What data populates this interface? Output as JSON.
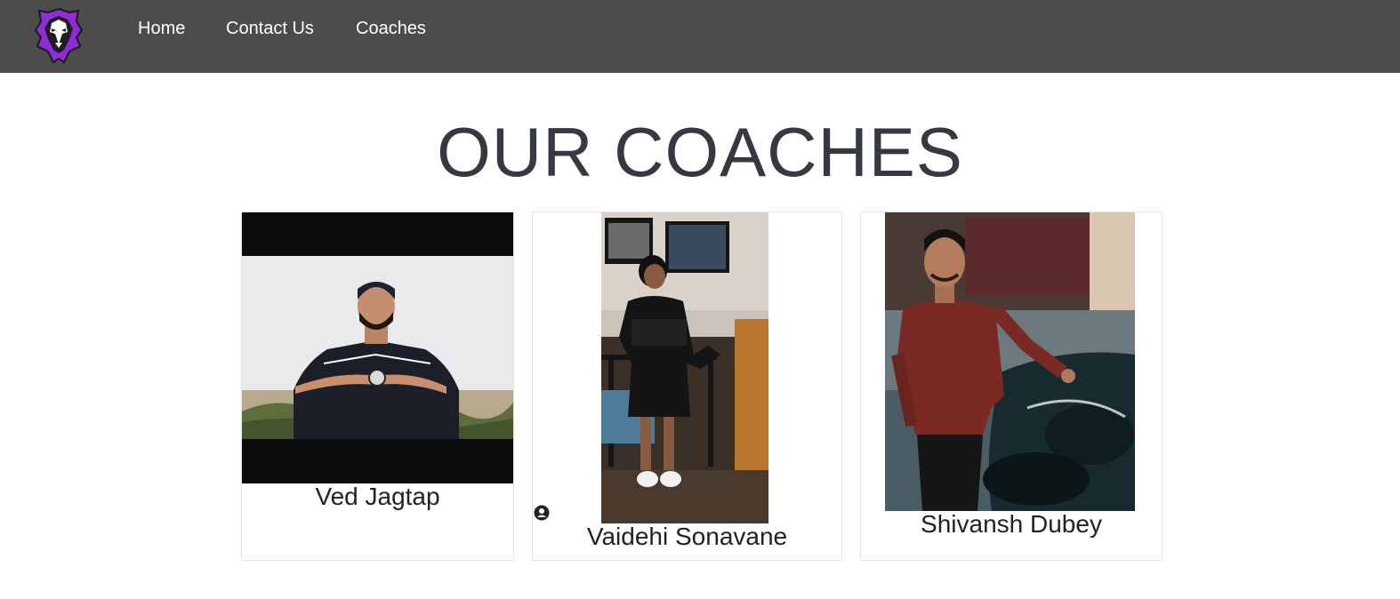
{
  "nav": {
    "logo_icon": "lion-head-logo-icon",
    "links": [
      {
        "label": "Home"
      },
      {
        "label": "Contact Us"
      },
      {
        "label": "Coaches"
      }
    ]
  },
  "main": {
    "title": "OUR COACHES",
    "coaches": [
      {
        "name": "Ved Jagtap",
        "photo": "man-making-heart-hands-photo"
      },
      {
        "name": "Vaidehi Sonavane",
        "photo": "woman-on-staircase-photo"
      },
      {
        "name": "Shivansh Dubey",
        "photo": "man-with-motorcycle-photo"
      }
    ]
  },
  "colors": {
    "navbar": "#4c4c4c",
    "title_text": "#343a40",
    "logo_accent": "#8f2cd6"
  }
}
